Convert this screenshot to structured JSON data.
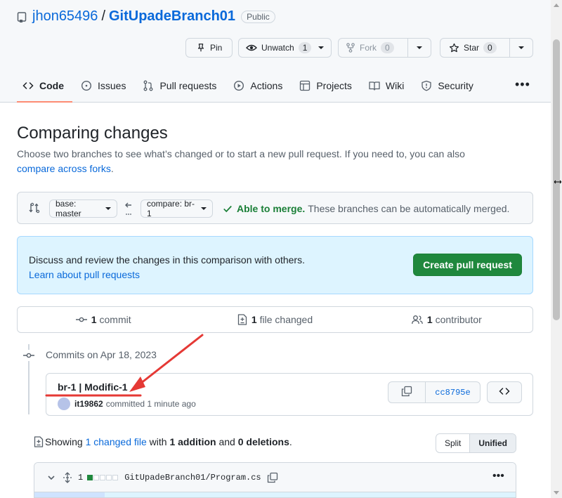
{
  "repo": {
    "owner": "jhon65496",
    "separator": "/",
    "name": "GitUpadeBranch01",
    "visibility": "Public"
  },
  "actions": {
    "pin": "Pin",
    "unwatch": "Unwatch",
    "unwatch_count": "1",
    "fork": "Fork",
    "fork_count": "0",
    "star": "Star",
    "star_count": "0"
  },
  "tabs": [
    {
      "label": "Code",
      "icon": "code-icon",
      "active": true
    },
    {
      "label": "Issues",
      "icon": "issue-icon"
    },
    {
      "label": "Pull requests",
      "icon": "pull-request-icon"
    },
    {
      "label": "Actions",
      "icon": "play-icon"
    },
    {
      "label": "Projects",
      "icon": "table-icon"
    },
    {
      "label": "Wiki",
      "icon": "book-icon"
    },
    {
      "label": "Security",
      "icon": "shield-icon"
    }
  ],
  "more": "•••",
  "page": {
    "title": "Comparing changes",
    "description": "Choose two branches to see what’s changed or to start a new pull request. If you need to, you can also",
    "compare_link": "compare across forks",
    "compare_suffix": "."
  },
  "range": {
    "base": "base: master",
    "compare": "compare: br-1",
    "merge_status": "Able to merge.",
    "merge_text": "These branches can be automatically merged."
  },
  "flash": {
    "message": "Discuss and review the changes in this comparison with others.",
    "link": "Learn about pull requests",
    "button": "Create pull request"
  },
  "summary": {
    "commits_count": "1",
    "commits_label": "commit",
    "files_count": "1",
    "files_label": "file changed",
    "contributors_count": "1",
    "contributors_label": "contributor"
  },
  "commits": {
    "date_label": "Commits on Apr 18, 2023",
    "items": [
      {
        "title": "br-1 | Modific-1",
        "author": "it19862",
        "meta": "committed 1 minute ago",
        "sha": "cc8795e"
      }
    ]
  },
  "files_summary": {
    "prefix": "Showing",
    "link": "1 changed file",
    "mid1": "with",
    "additions": "1 addition",
    "mid2": "and",
    "deletions": "0 deletions",
    "suffix": "."
  },
  "view_toggle": {
    "split": "Split",
    "unified": "Unified",
    "selected": "Unified"
  },
  "file": {
    "changes": "1",
    "path": "GitUpadeBranch01/Program.cs",
    "menu": "•••"
  },
  "colors": {
    "accent": "#0969da",
    "success": "#1f883d",
    "tab_underline": "#fd8c73",
    "annotation": "#e53935"
  }
}
